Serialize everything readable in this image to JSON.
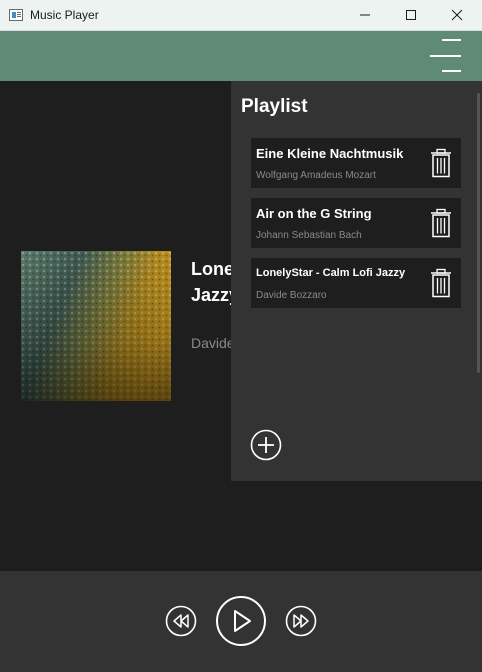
{
  "window": {
    "title": "Music Player",
    "icon": "app-window-icon",
    "controls": [
      "minimize-icon",
      "maximize-icon",
      "close-icon"
    ]
  },
  "header": {
    "background_color": "#5f8a73",
    "menu_icon": "hamburger-menu-icon"
  },
  "now_playing": {
    "title": "LonelyStar - Calm Lofi Jazzy",
    "artist": "Davide Bozzaro",
    "album_art": "wet-surface-raindrops-image"
  },
  "playlist": {
    "heading": "Playlist",
    "items": [
      {
        "title": "Eine Kleine Nachtmusik",
        "artist": "Wolfgang Amadeus Mozart"
      },
      {
        "title": "Air on the G String",
        "artist": "Johann Sebastian Bach"
      },
      {
        "title": "LonelyStar - Calm Lofi Jazzy",
        "artist": "Davide Bozzaro"
      }
    ],
    "item_icon": "trash-icon",
    "add_icon": "plus-circle-icon"
  },
  "controls": {
    "rewind_icon": "rewind-icon",
    "play_icon": "play-icon",
    "fast_forward_icon": "fast-forward-icon"
  },
  "colors": {
    "background": "#1e1e1e",
    "panel": "#333333",
    "text_primary": "#ffffff",
    "text_secondary": "#8a8a8a"
  }
}
